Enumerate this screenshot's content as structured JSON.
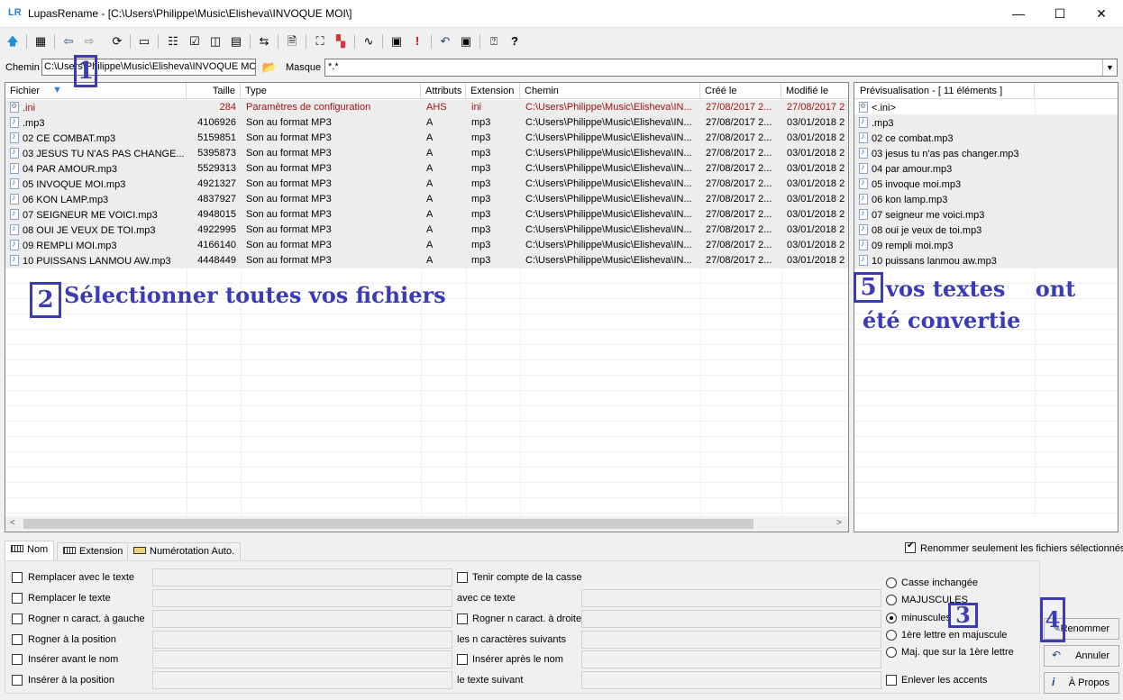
{
  "window": {
    "app_icon": "LR",
    "title": "LupasRename - [C:\\Users\\Philippe\\Music\\Elisheva\\INVOQUE MOI\\]",
    "minimize": "—",
    "maximize": "☐",
    "close": "✕"
  },
  "toolbar": {
    "icons": [
      "up-arrow-icon",
      "filter-icon",
      "back-icon",
      "forward-icon",
      "refresh-icon",
      "drive-icon",
      "tree-icon",
      "checklist-icon",
      "columns-icon",
      "details-icon",
      "move-icon",
      "document-icon",
      "image-icon",
      "color-icon",
      "chart-icon",
      "cmd-icon",
      "exclamation-icon",
      "undo-icon",
      "cmd2-icon",
      "help-doc-icon",
      "help-icon"
    ]
  },
  "path": {
    "label": "Chemin",
    "value": "C:\\Users\\Philippe\\Music\\Elisheva\\INVOQUE MC",
    "mask_label": "Masque",
    "mask_value": "*.*"
  },
  "files": {
    "columns": [
      "Fichier",
      "Taille",
      "Type",
      "Attributs",
      "Extension",
      "Chemin",
      "Créé le",
      "Modifié le"
    ],
    "rows": [
      {
        "name": ".ini",
        "size": "284",
        "type": "Paramètres de configuration",
        "attr": "AHS",
        "ext": "ini",
        "path": "C:\\Users\\Philippe\\Music\\Elisheva\\IN...",
        "created": "27/08/2017 2...",
        "modified": "27/08/2017 2",
        "icon": "ini"
      },
      {
        "name": ".mp3",
        "size": "4106926",
        "type": "Son au format MP3",
        "attr": "A",
        "ext": "mp3",
        "path": "C:\\Users\\Philippe\\Music\\Elisheva\\IN...",
        "created": "27/08/2017 2...",
        "modified": "03/01/2018 2",
        "icon": "mp3"
      },
      {
        "name": "02 CE COMBAT.mp3",
        "size": "5159851",
        "type": "Son au format MP3",
        "attr": "A",
        "ext": "mp3",
        "path": "C:\\Users\\Philippe\\Music\\Elisheva\\IN...",
        "created": "27/08/2017 2...",
        "modified": "03/01/2018 2",
        "icon": "mp3"
      },
      {
        "name": "03 JESUS TU N'AS PAS CHANGE...",
        "size": "5395873",
        "type": "Son au format MP3",
        "attr": "A",
        "ext": "mp3",
        "path": "C:\\Users\\Philippe\\Music\\Elisheva\\IN...",
        "created": "27/08/2017 2...",
        "modified": "03/01/2018 2",
        "icon": "mp3"
      },
      {
        "name": "04 PAR AMOUR.mp3",
        "size": "5529313",
        "type": "Son au format MP3",
        "attr": "A",
        "ext": "mp3",
        "path": "C:\\Users\\Philippe\\Music\\Elisheva\\IN...",
        "created": "27/08/2017 2...",
        "modified": "03/01/2018 2",
        "icon": "mp3"
      },
      {
        "name": "05 INVOQUE MOI.mp3",
        "size": "4921327",
        "type": "Son au format MP3",
        "attr": "A",
        "ext": "mp3",
        "path": "C:\\Users\\Philippe\\Music\\Elisheva\\IN...",
        "created": "27/08/2017 2...",
        "modified": "03/01/2018 2",
        "icon": "mp3"
      },
      {
        "name": "06 KON LAMP.mp3",
        "size": "4837927",
        "type": "Son au format MP3",
        "attr": "A",
        "ext": "mp3",
        "path": "C:\\Users\\Philippe\\Music\\Elisheva\\IN...",
        "created": "27/08/2017 2...",
        "modified": "03/01/2018 2",
        "icon": "mp3"
      },
      {
        "name": "07 SEIGNEUR ME VOICI.mp3",
        "size": "4948015",
        "type": "Son au format MP3",
        "attr": "A",
        "ext": "mp3",
        "path": "C:\\Users\\Philippe\\Music\\Elisheva\\IN...",
        "created": "27/08/2017 2...",
        "modified": "03/01/2018 2",
        "icon": "mp3"
      },
      {
        "name": "08 OUI JE VEUX DE TOI.mp3",
        "size": "4922995",
        "type": "Son au format MP3",
        "attr": "A",
        "ext": "mp3",
        "path": "C:\\Users\\Philippe\\Music\\Elisheva\\IN...",
        "created": "27/08/2017 2...",
        "modified": "03/01/2018 2",
        "icon": "mp3"
      },
      {
        "name": "09 REMPLI MOI.mp3",
        "size": "4166140",
        "type": "Son au format MP3",
        "attr": "A",
        "ext": "mp3",
        "path": "C:\\Users\\Philippe\\Music\\Elisheva\\IN...",
        "created": "27/08/2017 2...",
        "modified": "03/01/2018 2",
        "icon": "mp3"
      },
      {
        "name": "10 PUISSANS LANMOU AW.mp3",
        "size": "4448449",
        "type": "Son au format MP3",
        "attr": "A",
        "ext": "mp3",
        "path": "C:\\Users\\Philippe\\Music\\Elisheva\\IN...",
        "created": "27/08/2017 2...",
        "modified": "03/01/2018 2",
        "icon": "mp3"
      }
    ],
    "scroll_left": "<",
    "scroll_right": ">"
  },
  "preview": {
    "header": "Prévisualisation - [ 11 éléments ]",
    "items": [
      ".ini>",
      ".mp3",
      "02 ce combat.mp3",
      "03 jesus tu n'as pas changer.mp3",
      "04 par amour.mp3",
      "05 invoque moi.mp3",
      "06 kon lamp.mp3",
      "07 seigneur me voici.mp3",
      "08 oui je veux de toi.mp3",
      "09 rempli moi.mp3",
      "10 puissans lanmou aw.mp3"
    ],
    "first_prefix": "<"
  },
  "annotations": {
    "n1": "1",
    "n2": "2",
    "text2": "Sélectionner toutes vos fichiers",
    "n3": "3",
    "n4": "4",
    "n5": "5",
    "text5a": "vos textes    ont",
    "text5b": "été convertie"
  },
  "tabs": [
    "Nom",
    "Extension",
    "Numérotation Auto."
  ],
  "options": {
    "only_selected": "Renommer seulement les fichiers sélectionnés",
    "replace_with": "Remplacer avec le texte",
    "replace_text": "Remplacer le texte",
    "trim_left": "Rogner n caract. à gauche",
    "trim_pos": "Rogner à la position",
    "insert_before": "Insérer avant le nom",
    "insert_at": "Insérer à la position",
    "case_sensitive": "Tenir compte de la casse",
    "with_text": "avec ce texte",
    "trim_right": "Rogner n caract. à droite",
    "n_next": "les n caractères suivants",
    "insert_after": "Insérer après le nom",
    "following_text": "le texte suivant",
    "case_unchanged": "Casse inchangée",
    "uppercase": "MAJUSCULES",
    "lowercase": "minuscules",
    "first_upper": "1ère lettre en majuscule",
    "first_only": "Maj. que sur la 1ère lettre",
    "remove_accents": "Enlever les accents"
  },
  "buttons": {
    "rename": "Renommer",
    "cancel": "Annuler",
    "about": "À Propos"
  }
}
